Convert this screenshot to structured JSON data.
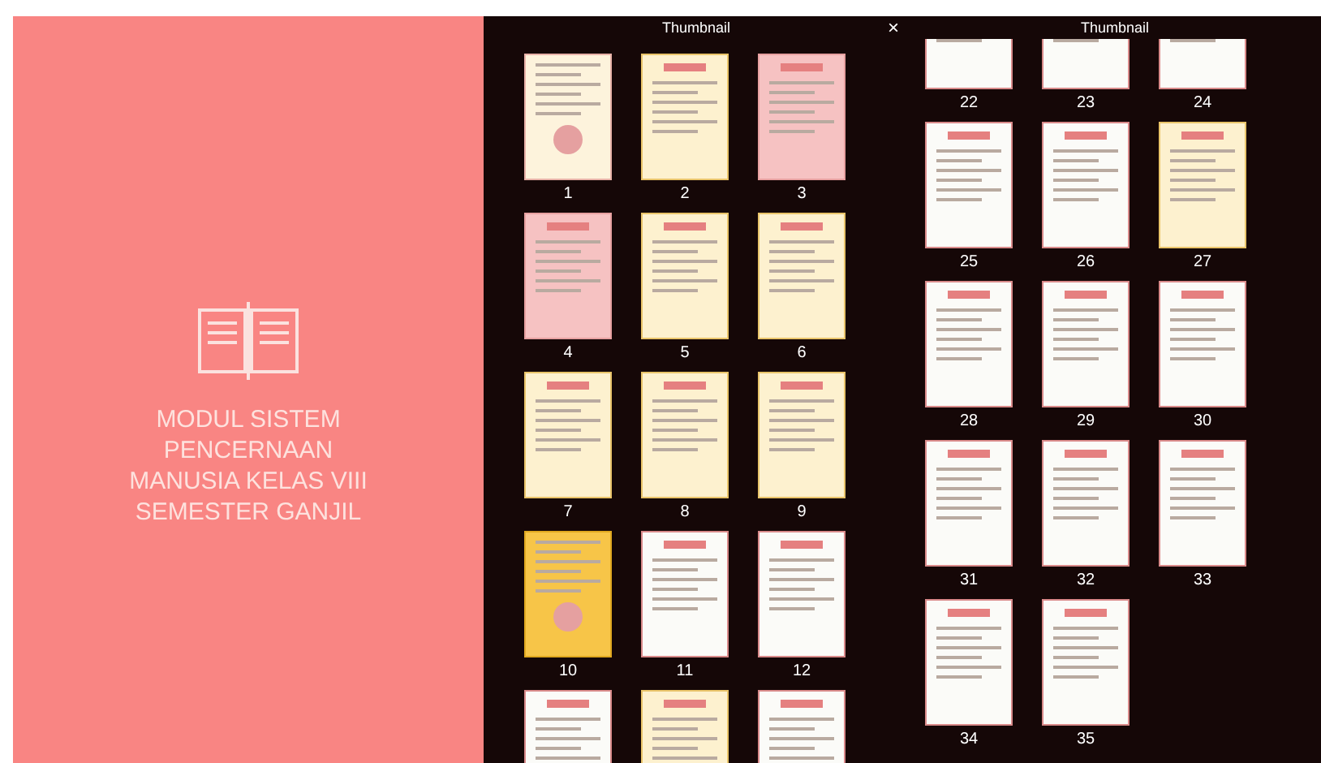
{
  "book": {
    "title": "MODUL SISTEM PENCERNAAN MANUSIA KELAS VIII SEMESTER GANJIL"
  },
  "close_label": "×",
  "panels": [
    {
      "title": "Thumbnail",
      "pages": [
        {
          "label": "1",
          "kind": "cover"
        },
        {
          "label": "2",
          "kind": "cream"
        },
        {
          "label": "3",
          "kind": "pink"
        },
        {
          "label": "4",
          "kind": "pink"
        },
        {
          "label": "5",
          "kind": "cream"
        },
        {
          "label": "6",
          "kind": "cream"
        },
        {
          "label": "7",
          "kind": "cream"
        },
        {
          "label": "8",
          "kind": "cream"
        },
        {
          "label": "9",
          "kind": "cream"
        },
        {
          "label": "10",
          "kind": "yellow"
        },
        {
          "label": "11",
          "kind": "white"
        },
        {
          "label": "12",
          "kind": "white"
        },
        {
          "kind": "white"
        },
        {
          "kind": "cream"
        },
        {
          "kind": "white"
        }
      ]
    },
    {
      "title": "Thumbnail",
      "pages": [
        {
          "label": "22",
          "kind": "white"
        },
        {
          "label": "23",
          "kind": "white"
        },
        {
          "label": "24",
          "kind": "white"
        },
        {
          "label": "25",
          "kind": "white"
        },
        {
          "label": "26",
          "kind": "white"
        },
        {
          "label": "27",
          "kind": "cream"
        },
        {
          "label": "28",
          "kind": "white"
        },
        {
          "label": "29",
          "kind": "white"
        },
        {
          "label": "30",
          "kind": "white"
        },
        {
          "label": "31",
          "kind": "white"
        },
        {
          "label": "32",
          "kind": "white"
        },
        {
          "label": "33",
          "kind": "white"
        },
        {
          "label": "34",
          "kind": "white"
        },
        {
          "label": "35",
          "kind": "white"
        }
      ]
    }
  ]
}
